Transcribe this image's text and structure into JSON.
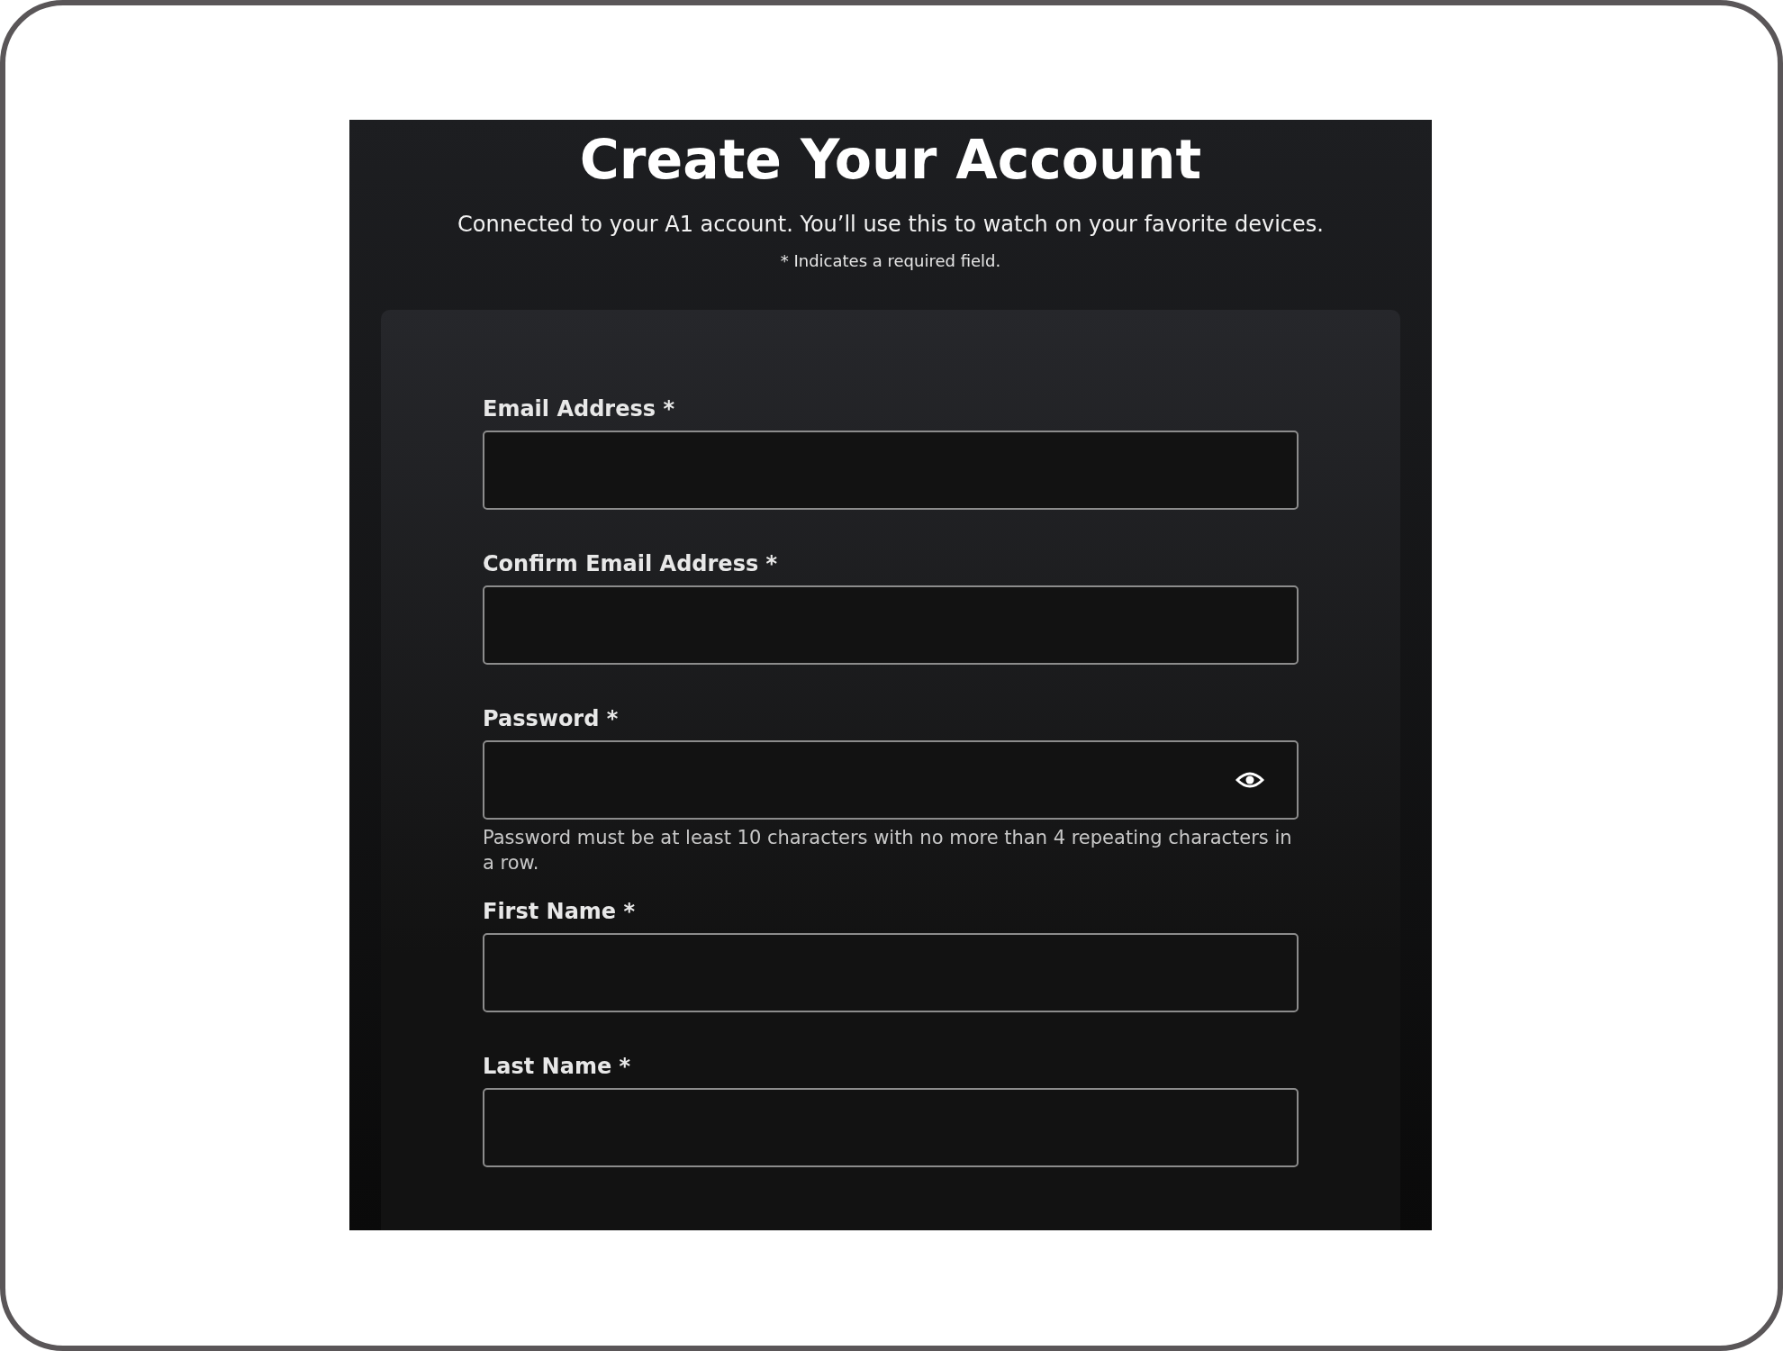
{
  "title": "Create Your Account",
  "subtitle": "Connected to your A1 account. You’ll use this to watch on your favorite devices.",
  "required_note": "* Indicates a required field.",
  "fields": [
    {
      "label": "Email Address *",
      "kind": "text"
    },
    {
      "label": "Confirm Email Address *",
      "kind": "text"
    },
    {
      "label": "Password *",
      "kind": "password",
      "hint": "Password must be at least 10 characters with no more than 4 repeating characters in a row."
    },
    {
      "label": "First Name *",
      "kind": "text"
    },
    {
      "label": "Last Name *",
      "kind": "text"
    }
  ]
}
